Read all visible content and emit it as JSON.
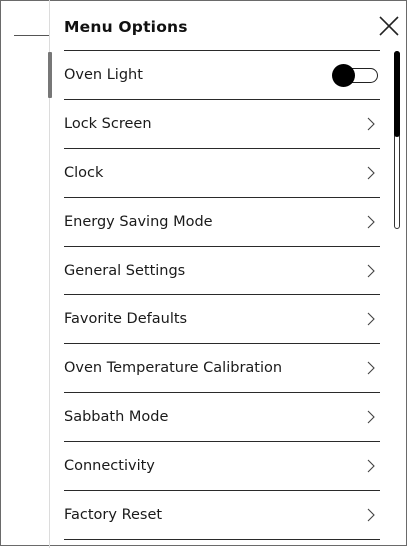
{
  "menu": {
    "title": "Menu Options",
    "items": [
      {
        "label": "Oven Light",
        "control": "toggle",
        "toggle_state": "on"
      },
      {
        "label": "Lock Screen",
        "control": "chevron"
      },
      {
        "label": "Clock",
        "control": "chevron"
      },
      {
        "label": "Energy Saving Mode",
        "control": "chevron"
      },
      {
        "label": "General Settings",
        "control": "chevron"
      },
      {
        "label": "Favorite Defaults",
        "control": "chevron"
      },
      {
        "label": "Oven Temperature Calibration",
        "control": "chevron"
      },
      {
        "label": "Sabbath Mode",
        "control": "chevron"
      },
      {
        "label": "Connectivity",
        "control": "chevron"
      },
      {
        "label": "Factory Reset",
        "control": "chevron"
      }
    ]
  },
  "icons": {
    "close": "close-icon",
    "chevron": "chevron-right-icon"
  },
  "colors": {
    "background": "#ffffff",
    "text": "#111111",
    "divider": "#2a2a2a",
    "toggle_knob": "#000000"
  }
}
